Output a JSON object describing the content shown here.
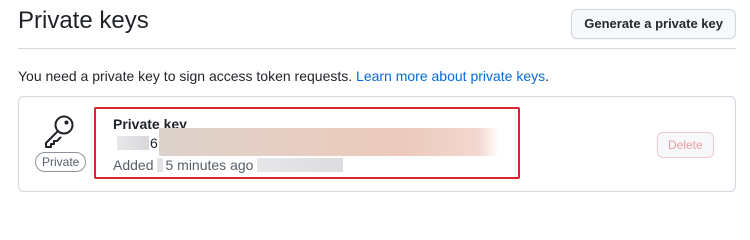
{
  "header": {
    "title": "Private keys",
    "generate_button_label": "Generate a private key"
  },
  "intro": {
    "text": "You need a private key to sign access token requests. ",
    "link_text": "Learn more about private keys",
    "trailing": "."
  },
  "key": {
    "icon": "key-icon",
    "visibility_badge": "Private",
    "title": "Private key",
    "fingerprint_visible_char": "6",
    "added_prefix": "Added",
    "added_time": "5 minutes ago",
    "delete_label": "Delete",
    "delete_disabled": true,
    "highlight_color": "#d9262e"
  },
  "colors": {
    "link": "#0969da",
    "danger_disabled": "#f09aa0",
    "border": "#d0d7de"
  }
}
